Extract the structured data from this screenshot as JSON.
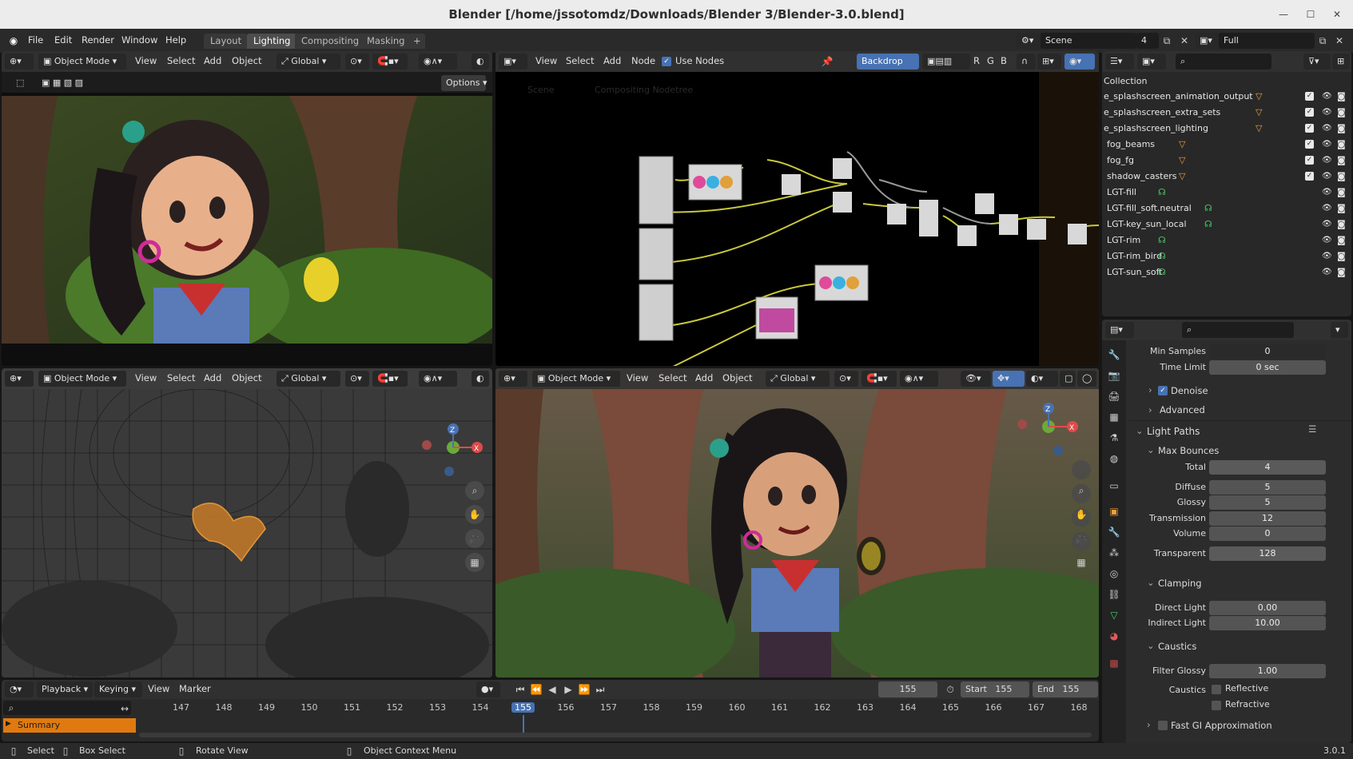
{
  "window": {
    "title": "Blender [/home/jssotomdz/Downloads/Blender 3/Blender-3.0.blend]"
  },
  "menu": [
    "File",
    "Edit",
    "Render",
    "Window",
    "Help"
  ],
  "workspaces": [
    "Layout",
    "Lighting",
    "Compositing",
    "Masking"
  ],
  "active_workspace": "Lighting",
  "scene": {
    "name": "Scene",
    "count": "4",
    "viewlayer": "Full"
  },
  "viewport_header": {
    "mode": "Object Mode",
    "view": "View",
    "select": "Select",
    "add": "Add",
    "object": "Object",
    "orientation": "Global",
    "options": "Options"
  },
  "compositor": {
    "view": "View",
    "select": "Select",
    "add": "Add",
    "node": "Node",
    "use_nodes": "Use Nodes",
    "backdrop": "Backdrop",
    "channels": [
      "R",
      "G",
      "B"
    ],
    "breadcrumb_scene": "Scene",
    "breadcrumb_tree": "Compositing Nodetree"
  },
  "outliner": {
    "root": "Collection",
    "items": [
      {
        "name": "e_splashscreen_animation_output",
        "checked": true
      },
      {
        "name": "e_splashscreen_extra_sets",
        "checked": true
      },
      {
        "name": "e_splashscreen_lighting",
        "checked": true
      },
      {
        "name": "fog_beams",
        "checked": true
      },
      {
        "name": "fog_fg",
        "checked": true
      },
      {
        "name": "shadow_casters",
        "checked": true
      },
      {
        "name": "LGT-fill",
        "checked": false
      },
      {
        "name": "LGT-fill_soft.neutral",
        "checked": false
      },
      {
        "name": "LGT-key_sun_local",
        "checked": false
      },
      {
        "name": "LGT-rim",
        "checked": false
      },
      {
        "name": "LGT-rim_bird",
        "checked": false
      },
      {
        "name": "LGT-sun_soft",
        "checked": false
      }
    ]
  },
  "properties": {
    "min_samples": {
      "label": "Min Samples",
      "value": "0"
    },
    "time_limit": {
      "label": "Time Limit",
      "value": "0 sec"
    },
    "denoise": "Denoise",
    "advanced": "Advanced",
    "light_paths": "Light Paths",
    "max_bounces": "Max Bounces",
    "bounces": [
      {
        "label": "Total",
        "value": "4"
      },
      {
        "label": "Diffuse",
        "value": "5"
      },
      {
        "label": "Glossy",
        "value": "5"
      },
      {
        "label": "Transmission",
        "value": "12"
      },
      {
        "label": "Volume",
        "value": "0"
      },
      {
        "label": "Transparent",
        "value": "128"
      }
    ],
    "clamping": "Clamping",
    "direct_light": {
      "label": "Direct Light",
      "value": "0.00"
    },
    "indirect_light": {
      "label": "Indirect Light",
      "value": "10.00"
    },
    "caustics_section": "Caustics",
    "filter_glossy": {
      "label": "Filter Glossy",
      "value": "1.00"
    },
    "caustics_label": "Caustics",
    "reflective": "Reflective",
    "refractive": "Refractive",
    "fast_gi": "Fast GI Approximation"
  },
  "timeline": {
    "playback": "Playback",
    "keying": "Keying",
    "view": "View",
    "marker": "Marker",
    "current_frame": "155",
    "start_label": "Start",
    "start": "155",
    "end_label": "End",
    "end": "155",
    "ticks": [
      "147",
      "148",
      "149",
      "150",
      "151",
      "152",
      "153",
      "154",
      "155",
      "156",
      "157",
      "158",
      "159",
      "160",
      "161",
      "162",
      "163",
      "164",
      "165",
      "166",
      "167",
      "168"
    ],
    "summary": "Summary"
  },
  "statusbar": {
    "select": "Select",
    "box_select": "Box Select",
    "rotate_view": "Rotate View",
    "context_menu": "Object Context Menu",
    "version": "3.0.1"
  },
  "colors": {
    "accent": "#4772b3",
    "selection_orange": "#f5a03a",
    "node_link": "#c8c83c"
  }
}
